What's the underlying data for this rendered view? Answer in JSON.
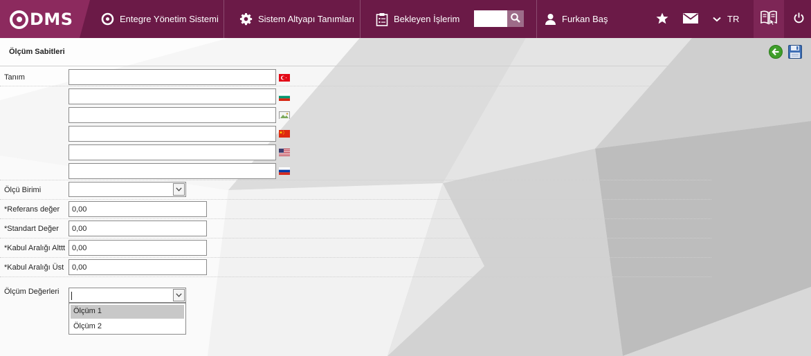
{
  "topbar": {
    "logo_text": "DMS",
    "nav": [
      {
        "label": "Entegre Yönetim Sistemi",
        "icon": "q-logo-icon"
      },
      {
        "label": "Sistem Altyapı Tanımları",
        "icon": "gear-icon"
      },
      {
        "label": "Bekleyen İşlerim",
        "icon": "clipboard-icon"
      }
    ],
    "search": {
      "value": "",
      "icon": "search-icon"
    },
    "user": {
      "name": "Furkan Baş",
      "icon": "user-icon"
    },
    "language": "TR",
    "icons": [
      "star-icon",
      "mail-icon",
      "chevron-down-icon",
      "help-book-icon",
      "power-icon"
    ]
  },
  "page": {
    "title": "Ölçüm Sabitleri",
    "back_icon": "back-arrow-icon",
    "save_icon": "save-icon"
  },
  "form": {
    "tanim": {
      "label": "Tanım",
      "languages": [
        {
          "flag": "turkey-flag-icon",
          "value": ""
        },
        {
          "flag": "bulgaria-flag-icon",
          "value": ""
        },
        {
          "flag": "broken-image-icon",
          "value": ""
        },
        {
          "flag": "china-flag-icon",
          "value": ""
        },
        {
          "flag": "usa-flag-icon",
          "value": ""
        },
        {
          "flag": "russia-flag-icon",
          "value": ""
        }
      ]
    },
    "olcu_birimi": {
      "label": "Ölçü Birimi",
      "value": ""
    },
    "referans": {
      "label": "*Referans değer",
      "value": "0,00"
    },
    "standart": {
      "label": "*Standart Değer",
      "value": "0,00"
    },
    "kabul_alt": {
      "label": "*Kabul Aralığı Alttt",
      "value": "0,00"
    },
    "kabul_ust": {
      "label": "*Kabul Aralığı Üst",
      "value": "0,00"
    },
    "olcum_degerleri": {
      "label": "Ölçüm Değerleri",
      "value": "",
      "options": [
        "Ölçüm 1",
        "Ölçüm 2"
      ],
      "highlighted": "Ölçüm 1"
    }
  },
  "colors": {
    "header": "#6b1a47",
    "logo_bg": "#8c2a5e",
    "accent_green": "#3f9e2a"
  }
}
